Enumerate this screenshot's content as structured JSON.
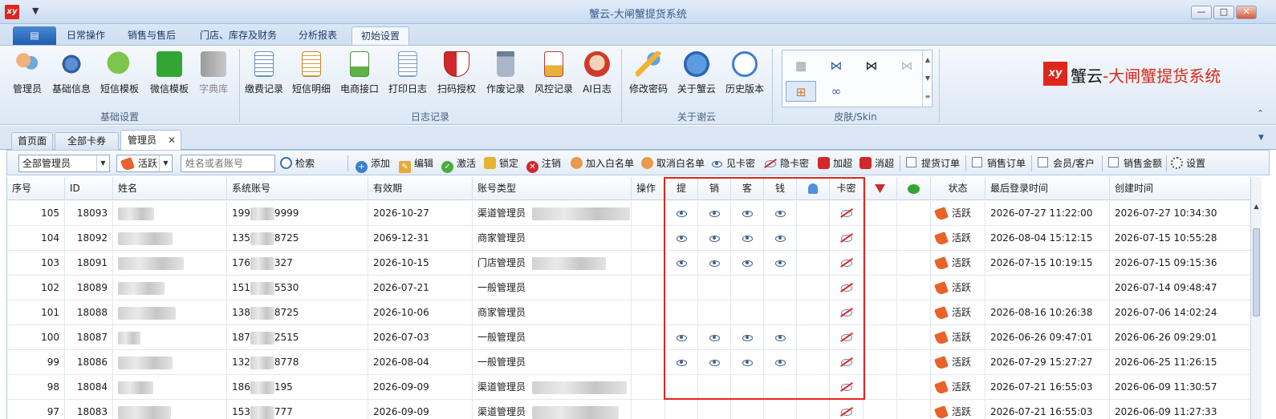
{
  "window": {
    "title": "蟹云-大闸蟹提货系统",
    "app_logo": "xy",
    "quick_access": "▼",
    "min": "—",
    "max": "□",
    "close": "✕"
  },
  "ribbon_tabs": {
    "menu_icon": "▤",
    "items": [
      "日常操作",
      "销售与售后",
      "门店、库存及财务",
      "分析报表",
      "初始设置"
    ],
    "active": "初始设置"
  },
  "ribbon": {
    "groups": [
      {
        "label": "基础设置",
        "buttons": [
          "管理员",
          "基础信息",
          "短信模板",
          "微信模板",
          "字典库"
        ]
      },
      {
        "label": "日志记录",
        "buttons": [
          "缴费记录",
          "短信明细",
          "电商接口",
          "打印日志",
          "扫码授权",
          "作废记录",
          "风控记录",
          "AI日志"
        ]
      },
      {
        "label": "关于谢云",
        "buttons": [
          "修改密码",
          "关于蟹云",
          "历史版本"
        ]
      },
      {
        "label": "皮肤/Skin",
        "buttons": []
      }
    ],
    "colors": {
      "blue": "#2f6fc0",
      "green": "#33a532",
      "red": "#d0282b",
      "orange": "#f2a23a",
      "gray": "#8d8d8d"
    },
    "collapse": "⌃"
  },
  "brand": {
    "mark": "xy",
    "name_black": "蟹云",
    "name_red": "-大闸蟹提货系统"
  },
  "doc_tabs": {
    "items": [
      "首页面",
      "全部卡券",
      "管理员"
    ],
    "active": "管理员",
    "close": "✕",
    "dropdown": "▼"
  },
  "toolbar": {
    "scope_select": "全部管理员",
    "status_select": "活跃",
    "search_placeholder": "姓名或者账号",
    "search_label": "检索",
    "actions": [
      "添加",
      "编辑",
      "激活",
      "锁定",
      "注销",
      "加入白名单",
      "取消白名单",
      "见卡密",
      "隐卡密",
      "加超",
      "消超"
    ],
    "checks": [
      "提货订单",
      "销售订单",
      "会员/客户",
      "销售金额"
    ],
    "settings": "设置"
  },
  "grid": {
    "headers": [
      "序号",
      "ID",
      "姓名",
      "系统账号",
      "有效期",
      "账号类型",
      "操作",
      "提",
      "销",
      "客",
      "钱",
      "",
      "卡密",
      "",
      "",
      "状态",
      "最后登录时间",
      "创建时间"
    ],
    "rows": [
      {
        "seq": "105",
        "id": "18093",
        "account_a": "199",
        "account_b": "9999",
        "expiry": "2026-10-27",
        "type": "渠道管理员",
        "t": true,
        "x": true,
        "k": true,
        "q": true,
        "status": "活跃",
        "last_login": "2026-07-27 11:22:00",
        "created": "2026-07-27 10:34:30"
      },
      {
        "seq": "104",
        "id": "18092",
        "account_a": "135",
        "account_b": "8725",
        "expiry": "2069-12-31",
        "type": "商家管理员",
        "t": true,
        "x": true,
        "k": true,
        "q": true,
        "status": "活跃",
        "last_login": "2026-08-04 15:12:15",
        "created": "2026-07-15 10:55:28"
      },
      {
        "seq": "103",
        "id": "18091",
        "account_a": "176",
        "account_b": "327",
        "expiry": "2026-10-15",
        "type": "门店管理员",
        "t": true,
        "x": true,
        "k": true,
        "q": true,
        "status": "活跃",
        "last_login": "2026-07-15 10:19:15",
        "created": "2026-07-15 09:15:36"
      },
      {
        "seq": "102",
        "id": "18089",
        "account_a": "151",
        "account_b": "5530",
        "expiry": "2026-07-21",
        "type": "一般管理员",
        "t": false,
        "x": false,
        "k": false,
        "q": false,
        "status": "活跃",
        "last_login": "",
        "created": "2026-07-14 09:48:47"
      },
      {
        "seq": "101",
        "id": "18088",
        "account_a": "138",
        "account_b": "8725",
        "expiry": "2026-10-06",
        "type": "商家管理员",
        "t": false,
        "x": false,
        "k": false,
        "q": false,
        "status": "活跃",
        "last_login": "2026-08-16 10:26:38",
        "created": "2026-07-06 14:02:24"
      },
      {
        "seq": "100",
        "id": "18087",
        "account_a": "187",
        "account_b": "2515",
        "expiry": "2026-07-03",
        "type": "一般管理员",
        "t": true,
        "x": true,
        "k": true,
        "q": true,
        "status": "活跃",
        "last_login": "2026-06-26 09:47:01",
        "created": "2026-06-26 09:29:01"
      },
      {
        "seq": "99",
        "id": "18086",
        "account_a": "132",
        "account_b": "8778",
        "expiry": "2026-08-04",
        "type": "一般管理员",
        "t": true,
        "x": true,
        "k": true,
        "q": true,
        "status": "活跃",
        "last_login": "2026-07-29 15:27:27",
        "created": "2026-06-25 11:26:15"
      },
      {
        "seq": "98",
        "id": "18084",
        "account_a": "186",
        "account_b": "195",
        "expiry": "2026-09-09",
        "type": "渠道管理员",
        "t": false,
        "x": false,
        "k": false,
        "q": false,
        "status": "活跃",
        "last_login": "2026-07-21 16:55:03",
        "created": "2026-06-09 11:30:57"
      },
      {
        "seq": "97",
        "id": "18083",
        "account_a": "153",
        "account_b": "777",
        "expiry": "2026-09-09",
        "type": "渠道管理员",
        "t": false,
        "x": false,
        "k": false,
        "q": false,
        "status": "活跃",
        "last_login": "2026-07-21 16:55:03",
        "created": "2026-06-09 11:27:33"
      }
    ]
  }
}
